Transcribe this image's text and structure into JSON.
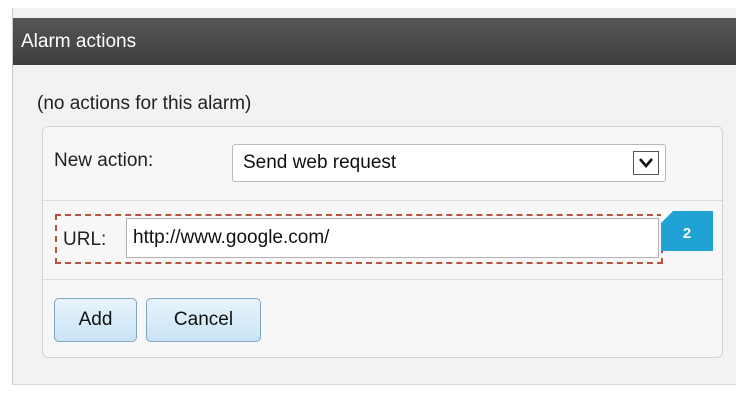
{
  "panel": {
    "title": "Alarm actions",
    "empty_message": "(no actions for this alarm)"
  },
  "form": {
    "new_action_label": "New action:",
    "new_action_selected": "Send web request",
    "url_label": "URL:",
    "url_value": "http://www.google.com/",
    "add_label": "Add",
    "cancel_label": "Cancel"
  },
  "callout": {
    "number": "2"
  },
  "colors": {
    "titlebar": "#4a4a4a",
    "highlight_dash": "#b5533f",
    "callout": "#20a2d5",
    "button": "#c9e3f5"
  },
  "icons": {
    "select_arrow": "chevron-down-icon"
  }
}
